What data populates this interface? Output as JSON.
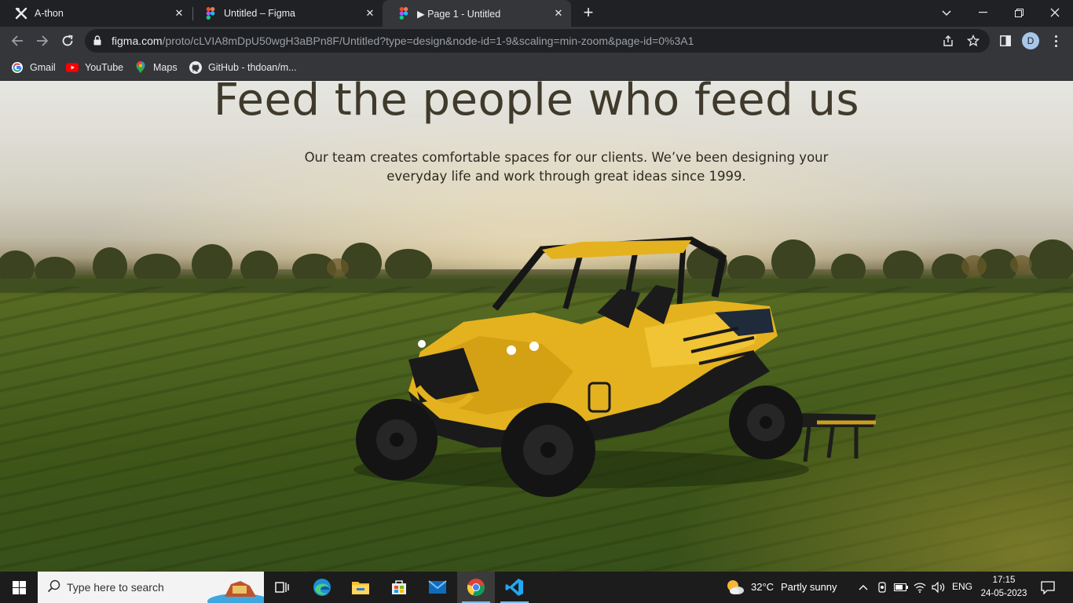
{
  "browser": {
    "tabs": [
      {
        "title": "A-thon",
        "icon": "athon-icon",
        "active": false
      },
      {
        "title": "Untitled – Figma",
        "icon": "figma-icon",
        "active": false
      },
      {
        "title": "▶ Page 1 - Untitled",
        "icon": "figma-icon",
        "active": true
      }
    ],
    "url_host": "figma.com",
    "url_path": "/proto/cLVIA8mDpU50wgH3aBPn8F/Untitled?type=design&node-id=1-9&scaling=min-zoom&page-id=0%3A1",
    "profile_initial": "D",
    "bookmarks": [
      {
        "label": "Gmail",
        "icon": "google-icon"
      },
      {
        "label": "YouTube",
        "icon": "youtube-icon"
      },
      {
        "label": "Maps",
        "icon": "maps-icon"
      },
      {
        "label": "GitHub - thdoan/m...",
        "icon": "github-icon"
      }
    ]
  },
  "page": {
    "title": "Feed the people who feed us",
    "subtitle": "Our team creates comfortable spaces for our clients. We’ve been designing your everyday life and work through great ideas since 1999.",
    "colors": {
      "title": "#3f3a2b",
      "vehicle_accent": "#e4b21f"
    }
  },
  "taskbar": {
    "search_placeholder": "Type here to search",
    "apps": [
      "task-view",
      "edge",
      "file-explorer",
      "microsoft-store",
      "mail",
      "chrome",
      "vscode"
    ],
    "weather_temp": "32°C",
    "weather_desc": "Partly sunny",
    "language": "ENG",
    "time": "17:15",
    "date": "24-05-2023"
  }
}
